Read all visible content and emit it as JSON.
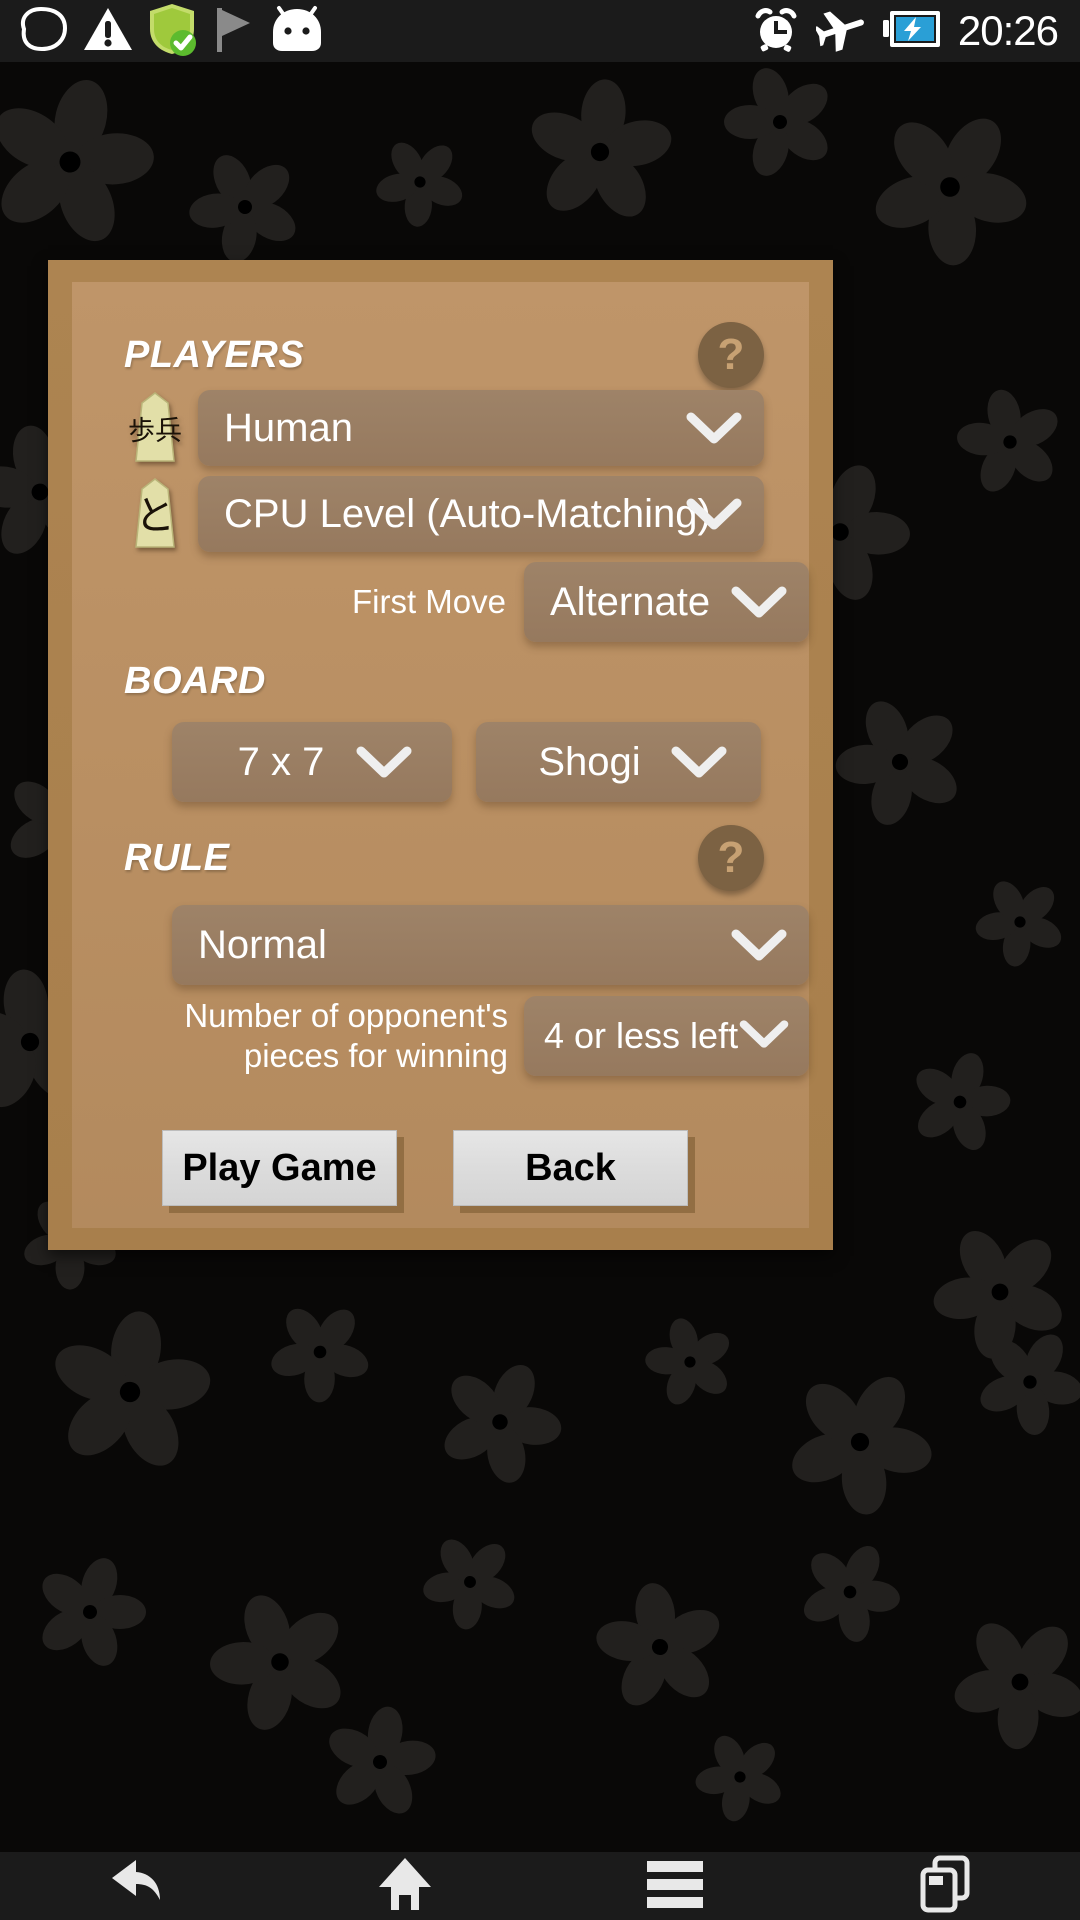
{
  "status_bar": {
    "icons_left": [
      "cloud-outline-icon",
      "warning-triangle-icon",
      "shield-check-icon",
      "flag-icon",
      "android-head-icon"
    ],
    "icons_right": [
      "alarm-clock-icon",
      "airplane-mode-icon",
      "battery-charging-icon"
    ],
    "clock": "20:26"
  },
  "dialog": {
    "players": {
      "title": "PLAYERS",
      "help_label": "?",
      "rows": [
        {
          "piece_glyph": "歩兵",
          "piece_name": "pawn-piece-icon",
          "value": "Human"
        },
        {
          "piece_glyph": "と",
          "piece_name": "promoted-pawn-piece-icon",
          "value": "CPU Level (Auto-Matching)"
        }
      ],
      "first_move_label": "First Move",
      "first_move_value": "Alternate"
    },
    "board": {
      "title": "BOARD",
      "size_value": "7 x 7",
      "type_value": "Shogi"
    },
    "rule": {
      "title": "RULE",
      "help_label": "?",
      "rule_value": "Normal",
      "win_condition_label": "Number of opponent's\npieces for winning",
      "win_condition_line1": "Number of opponent's",
      "win_condition_line2": "pieces for winning",
      "win_condition_value": "4 or less left"
    },
    "actions": {
      "play_label": "Play Game",
      "back_label": "Back"
    }
  },
  "nav_bar": {
    "buttons": [
      "back-nav-icon",
      "home-nav-icon",
      "menu-nav-icon",
      "recents-nav-icon"
    ]
  },
  "colors": {
    "panel_outer": "#ad8451",
    "panel_inner": "#bf9569",
    "dropdown": "#9e8368",
    "help_circle": "#7c6243",
    "help_mark": "#c7a173",
    "button_face": "#e0e0e0",
    "status_bar": "#1b1b1b",
    "background": "#090807"
  }
}
